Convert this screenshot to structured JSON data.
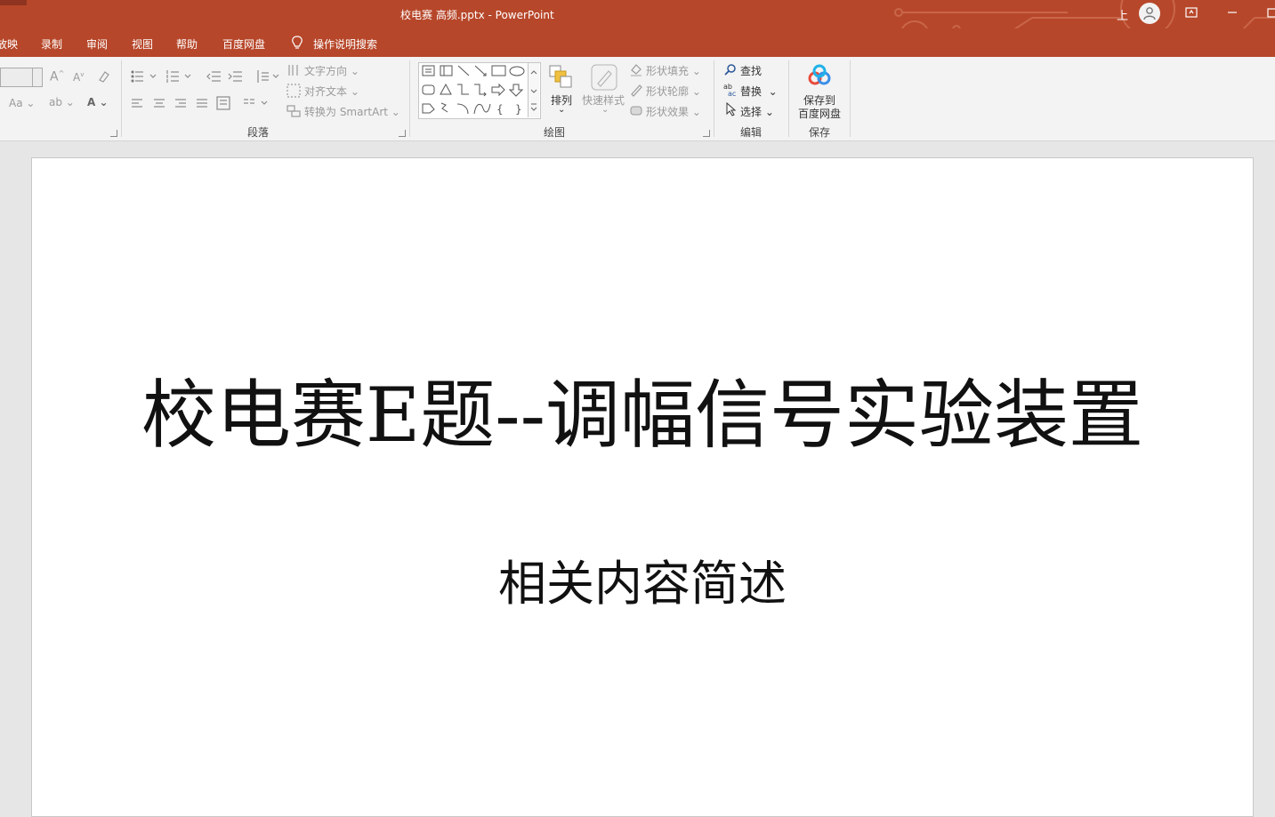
{
  "window": {
    "title": "校电赛 高频.pptx  -  PowerPoint",
    "user_initial": "上",
    "accent_color": "#b7472a"
  },
  "tabs": [
    "放映",
    "录制",
    "审阅",
    "视图",
    "帮助",
    "百度网盘"
  ],
  "tell_me": "操作说明搜索",
  "ribbon": {
    "font_size_label": "Aa",
    "paragraph": {
      "text_direction": "文字方向",
      "align_text": "对齐文本",
      "convert_smartart": "转换为 SmartArt",
      "group_label": "段落"
    },
    "drawing": {
      "arrange": "排列",
      "quick_styles": "快速样式",
      "shape_fill": "形状填充",
      "shape_outline": "形状轮廓",
      "shape_effects": "形状效果",
      "group_label": "绘图"
    },
    "editing": {
      "find": "查找",
      "replace": "替换",
      "select": "选择",
      "group_label": "编辑"
    },
    "save": {
      "save_to_line1": "保存到",
      "save_to_line2": "百度网盘",
      "group_label": "保存"
    }
  },
  "slide": {
    "title": "校电赛E题--调幅信号实验装置",
    "subtitle": "相关内容简述"
  }
}
